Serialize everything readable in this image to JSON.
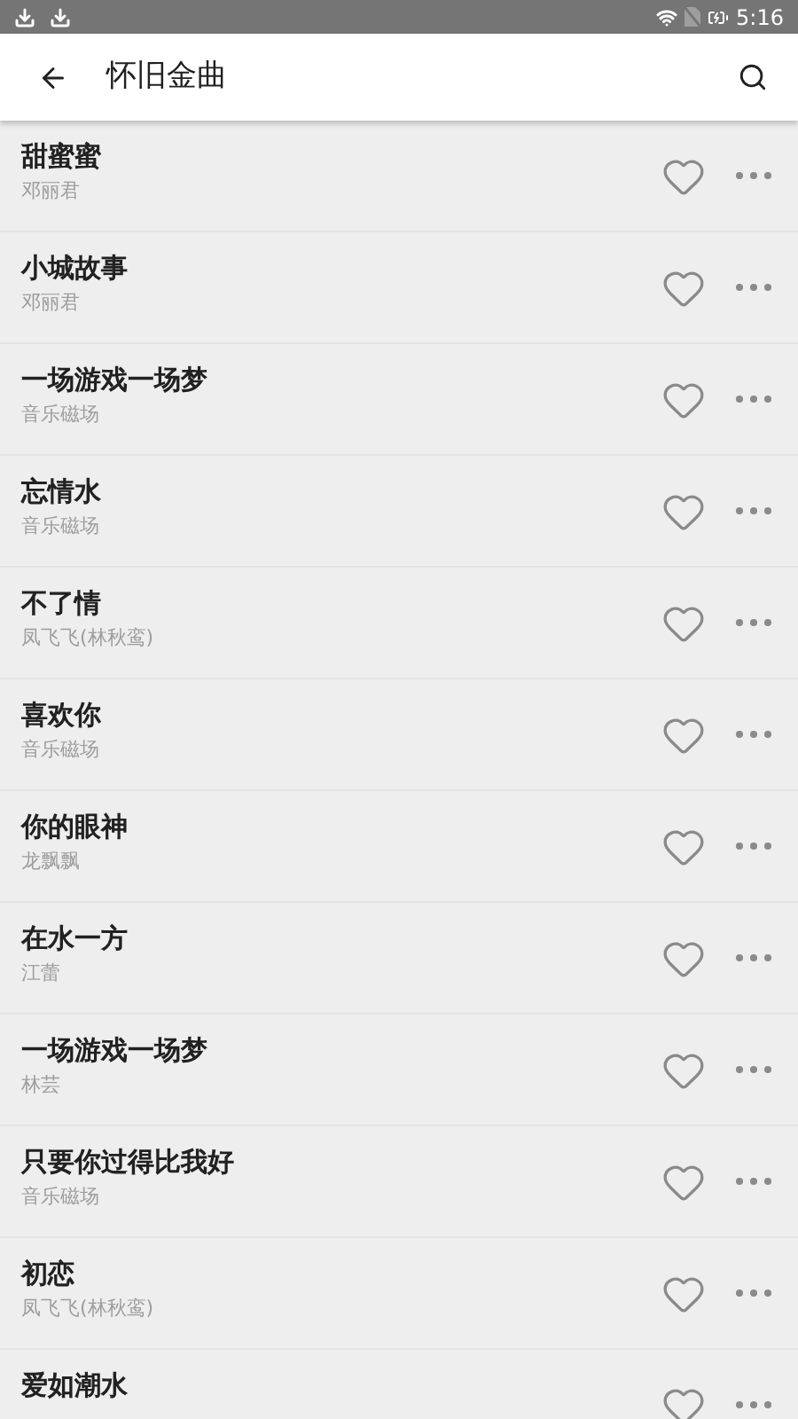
{
  "status_bar": {
    "time": "5:16"
  },
  "toolbar": {
    "title": "怀旧金曲"
  },
  "songs": [
    {
      "title": "甜蜜蜜",
      "artist": "邓丽君",
      "favorite": false
    },
    {
      "title": "小城故事",
      "artist": "邓丽君",
      "favorite": false
    },
    {
      "title": "一场游戏一场梦",
      "artist": "音乐磁场",
      "favorite": false
    },
    {
      "title": "忘情水",
      "artist": "音乐磁场",
      "favorite": false
    },
    {
      "title": "不了情",
      "artist": "凤飞飞(林秋鸾)",
      "favorite": false
    },
    {
      "title": "喜欢你",
      "artist": "音乐磁场",
      "favorite": false
    },
    {
      "title": "你的眼神",
      "artist": "龙飘飘",
      "favorite": false
    },
    {
      "title": "在水一方",
      "artist": "江蕾",
      "favorite": false
    },
    {
      "title": "一场游戏一场梦",
      "artist": "林芸",
      "favorite": false
    },
    {
      "title": "只要你过得比我好",
      "artist": "音乐磁场",
      "favorite": false
    },
    {
      "title": "初恋",
      "artist": "凤飞飞(林秋鸾)",
      "favorite": false
    },
    {
      "title": "爱如潮水",
      "favorite": false
    }
  ]
}
